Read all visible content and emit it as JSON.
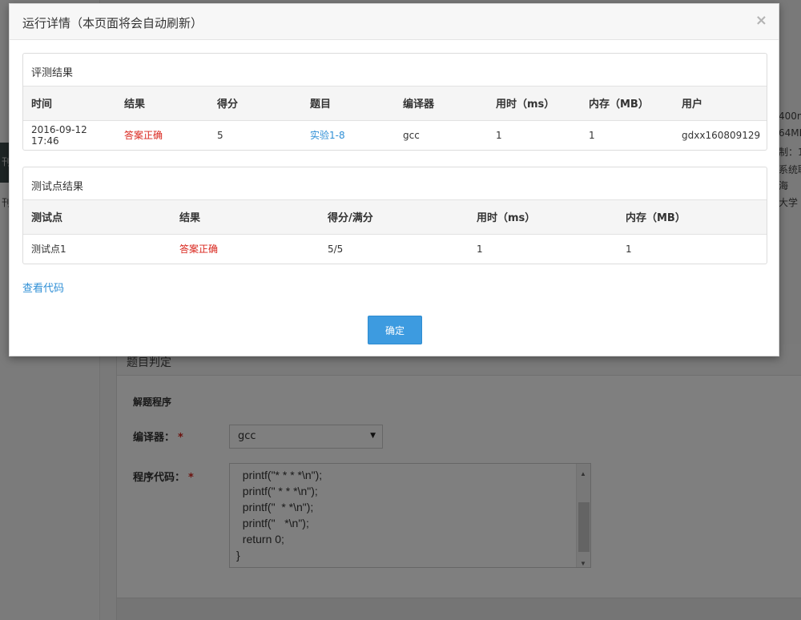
{
  "modal": {
    "title": "运行详情（本页面将会自动刷新）",
    "close_symbol": "×",
    "view_code_link": "查看代码",
    "ok_button": "确定"
  },
  "eval_panel": {
    "heading": "评测结果",
    "columns": [
      "时间",
      "结果",
      "得分",
      "题目",
      "编译器",
      "用时（ms）",
      "内存（MB）",
      "用户"
    ],
    "row": {
      "time": "2016-09-12 17:46",
      "result": "答案正确",
      "score": "5",
      "problem": "实验1-8",
      "compiler": "gcc",
      "time_ms": "1",
      "memory_mb": "1",
      "user": "gdxx160809129"
    }
  },
  "testpoint_panel": {
    "heading": "测试点结果",
    "columns": [
      "测试点",
      "结果",
      "得分/满分",
      "用时（ms）",
      "内存（MB）"
    ],
    "rows": [
      {
        "name": "测试点1",
        "result": "答案正确",
        "score": "5/5",
        "time_ms": "1",
        "memory_mb": "1"
      }
    ]
  },
  "background_page": {
    "right_fragments": [
      "400m",
      "64MI",
      "制：1",
      "系统职",
      "海",
      "大学"
    ],
    "left_fragments": [
      "刊",
      "刊"
    ],
    "judge_section_title": "题目判定",
    "solution_label": "解题程序",
    "compiler_label": "编译器：",
    "compiler_value": "gcc",
    "code_label": "程序代码：",
    "required_mark": "*",
    "code_lines": [
      "  printf(\"* * * *\\n\");",
      "  printf(\" * * *\\n\");",
      "  printf(\"  * *\\n\");",
      "  printf(\"   *\\n\");",
      "  return 0;",
      "}"
    ]
  },
  "colors": {
    "accent": "#3d9be0",
    "error_red": "#d9251c",
    "link_blue": "#2f8fd6"
  }
}
